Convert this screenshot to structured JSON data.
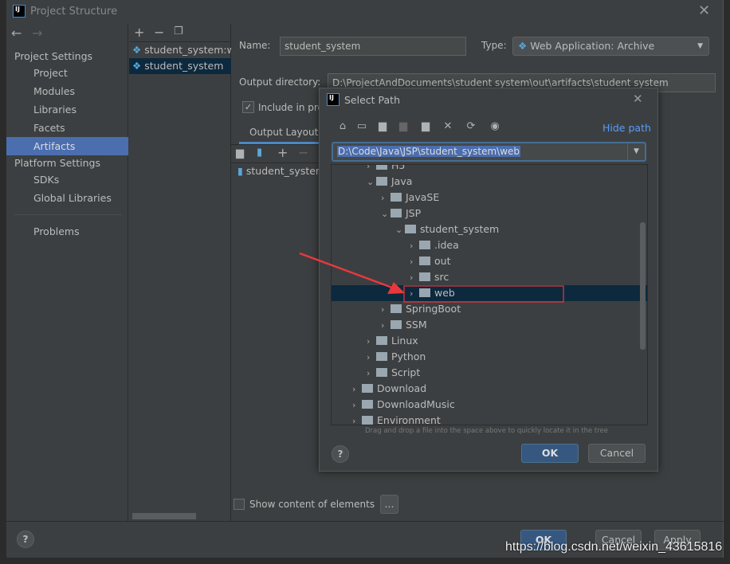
{
  "window": {
    "title": "Project Structure"
  },
  "sidebar": {
    "project_settings": "Project Settings",
    "items": [
      "Project",
      "Modules",
      "Libraries",
      "Facets",
      "Artifacts"
    ],
    "platform_settings": "Platform Settings",
    "platform_items": [
      "SDKs",
      "Global Libraries"
    ],
    "problems": "Problems",
    "selected": "Artifacts"
  },
  "artifacts": {
    "items": [
      "student_system:war exploded",
      "student_system"
    ],
    "selected": "student_system"
  },
  "form": {
    "name_label": "Name:",
    "name_value": "student_system",
    "type_label": "Type:",
    "type_value": "Web Application: Archive",
    "output_label": "Output directory:",
    "output_value": "D:\\ProjectAndDocuments\\student system\\out\\artifacts\\student system",
    "include_label": "Include in project build",
    "include_checked": true,
    "tab_output_layout": "Output Layout",
    "layout_item": "student_system.war",
    "show_content_label": "Show content of elements",
    "show_content_checked": false,
    "more_button": "..."
  },
  "footer": {
    "ok": "OK",
    "cancel": "Cancel",
    "apply": "Apply",
    "help": "?"
  },
  "dialog": {
    "title": "Select Path",
    "hide_path": "Hide path",
    "path_value": "D:\\Code\\Java\\JSP\\student_system\\web",
    "hint": "Drag and drop a file into the space above to quickly locate it in the tree",
    "ok": "OK",
    "cancel": "Cancel",
    "help": "?",
    "tree": [
      {
        "label": "H5",
        "level": 2,
        "expanded": false
      },
      {
        "label": "Java",
        "level": 2,
        "expanded": true
      },
      {
        "label": "JavaSE",
        "level": 3,
        "expanded": false
      },
      {
        "label": "JSP",
        "level": 3,
        "expanded": true
      },
      {
        "label": "student_system",
        "level": 4,
        "expanded": true
      },
      {
        "label": ".idea",
        "level": 5,
        "expanded": false
      },
      {
        "label": "out",
        "level": 5,
        "expanded": false
      },
      {
        "label": "src",
        "level": 5,
        "expanded": false
      },
      {
        "label": "web",
        "level": 5,
        "expanded": false,
        "selected": true
      },
      {
        "label": "SpringBoot",
        "level": 3,
        "expanded": false
      },
      {
        "label": "SSM",
        "level": 3,
        "expanded": false
      },
      {
        "label": "Linux",
        "level": 2,
        "expanded": false
      },
      {
        "label": "Python",
        "level": 2,
        "expanded": false
      },
      {
        "label": "Script",
        "level": 2,
        "expanded": false
      },
      {
        "label": "Download",
        "level": 1,
        "expanded": false
      },
      {
        "label": "DownloadMusic",
        "level": 1,
        "expanded": false
      },
      {
        "label": "Environment",
        "level": 1,
        "expanded": false
      }
    ]
  },
  "watermark": "https://blog.csdn.net/weixin_43615816",
  "colors": {
    "accent": "#4b6eaf",
    "selection": "#0d293e",
    "link": "#589df6",
    "annotation": "#e8383d"
  }
}
